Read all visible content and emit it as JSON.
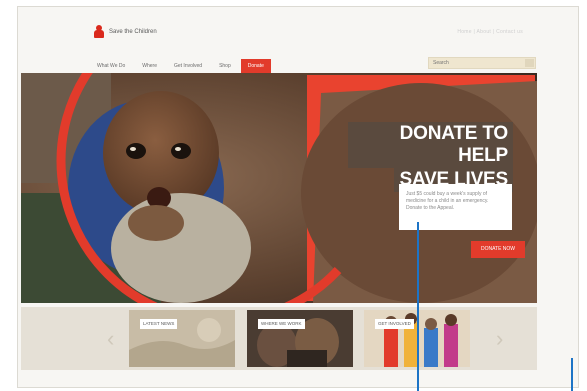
{
  "header": {
    "logo_text": "Save the Children",
    "top_links": "Home   |   About   |   Contact us",
    "search_placeholder": "Search"
  },
  "nav": {
    "items": [
      {
        "label": "What We Do"
      },
      {
        "label": "Where"
      },
      {
        "label": "Get Involved"
      },
      {
        "label": "Shop"
      },
      {
        "label": "Donate",
        "active": true
      }
    ]
  },
  "hero": {
    "headline_line1": "DONATE TO HELP",
    "headline_line2": "SAVE LIVES",
    "body": "Just $5 could buy a week's supply of medicine for a child in an emergency. Donate to the Appeal.",
    "cta": "DONATE NOW"
  },
  "carousel": {
    "prev": "‹",
    "next": "›",
    "slides": [
      {
        "label": "LATEST NEWS"
      },
      {
        "label": "WHERE WE WORK"
      },
      {
        "label": "GET INVOLVED"
      }
    ]
  },
  "colors": {
    "brand_red": "#e23b2b",
    "marker_blue": "#1d74c6"
  }
}
